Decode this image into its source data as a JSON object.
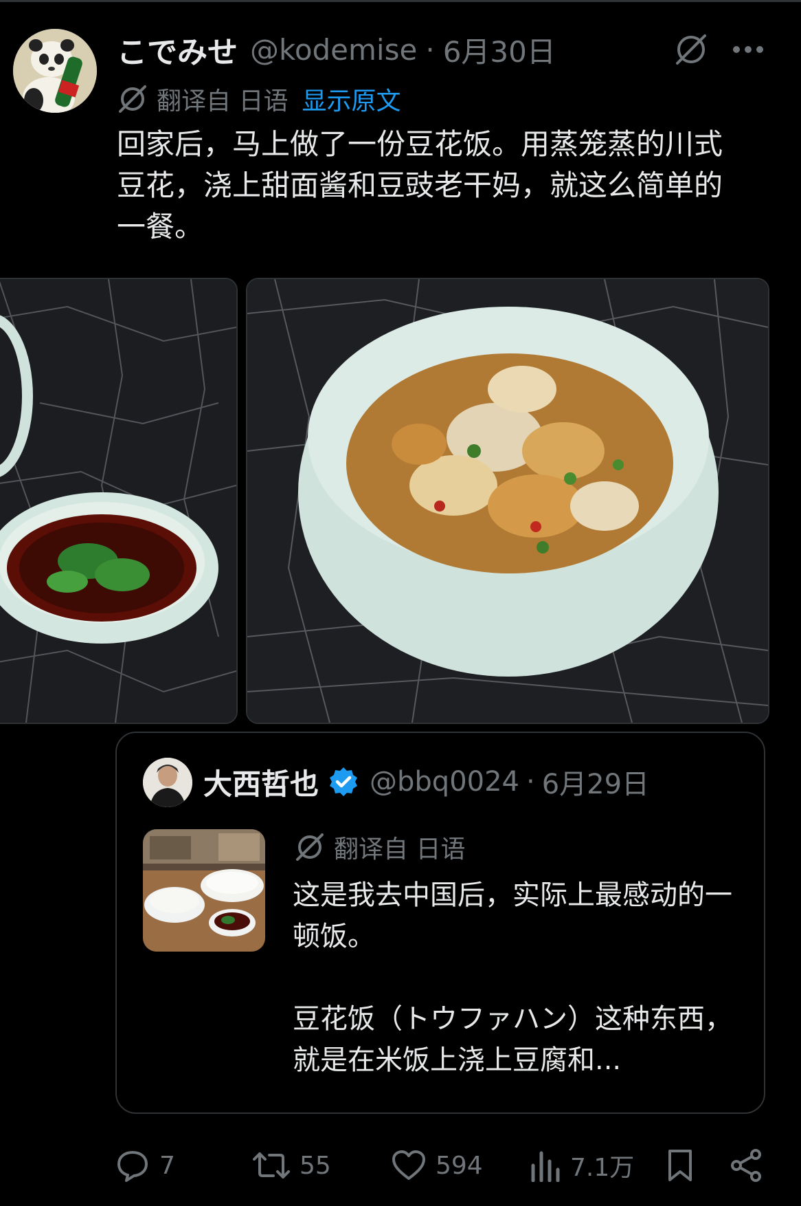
{
  "tweet": {
    "display_name": "こでみせ",
    "handle": "@kodemise",
    "separator": "·",
    "date": "6月30日",
    "translation_label": "翻译自 日语",
    "show_original": "显示原文",
    "text": "回家后，马上做了一份豆花饭。用蒸笼蒸的川式豆花，浇上甜面酱和豆豉老干妈，就这么简单的一餐。"
  },
  "quoted": {
    "display_name": "大西哲也",
    "handle": "@bbq0024",
    "separator": "·",
    "date": "6月29日",
    "translation_label": "翻译自 日语",
    "text": "这是我去中国后，实际上最感动的一顿饭。\n\n豆花饭（トウファハン）这种东西，就是在米饭上浇上豆腐和..."
  },
  "actions": {
    "replies": "7",
    "reposts": "55",
    "likes": "594",
    "views": "7.1万"
  },
  "icons": {
    "grok": "grok-icon",
    "more": "more-icon",
    "translate": "translate-icon",
    "verified": "verified-badge-icon",
    "reply": "reply-icon",
    "repost": "repost-icon",
    "like": "like-icon",
    "views": "views-icon",
    "bookmark": "bookmark-icon",
    "share": "share-icon"
  },
  "colors": {
    "background": "#000000",
    "text": "#e7e9ea",
    "muted": "#71767b",
    "link": "#1d9bf0",
    "verified": "#1d9bf0",
    "border": "#2f3336"
  }
}
